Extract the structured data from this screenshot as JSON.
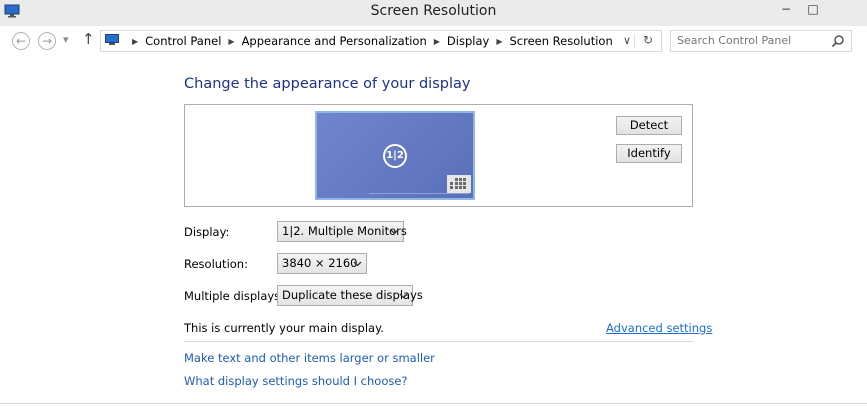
{
  "window": {
    "title": "Screen Resolution",
    "minimize_label": "−",
    "maximize_label": "□"
  },
  "nav": {
    "back_glyph": "←",
    "forward_glyph": "→",
    "recent_glyph": "▾",
    "up_glyph": "↑",
    "breadcrumbs": [
      "Control Panel",
      "Appearance and Personalization",
      "Display",
      "Screen Resolution"
    ],
    "crumb_sep": "▶",
    "dropdown_glyph": "∨",
    "refresh_glyph": "↻",
    "search_placeholder": "Search Control Panel"
  },
  "main": {
    "heading": "Change the appearance of your display",
    "monitor_label": "1|2",
    "detect_label": "Detect",
    "identify_label": "Identify",
    "display_label": "Display:",
    "display_value": "1|2. Multiple Monitors",
    "resolution_label": "Resolution:",
    "resolution_value": "3840 × 2160",
    "multiple_label": "Multiple displays:",
    "multiple_value": "Duplicate these displays",
    "main_display_text": "This is currently your main display.",
    "advanced_link": "Advanced settings",
    "link_text_size": "Make text and other items larger or smaller",
    "link_settings": "What display settings should I choose?"
  },
  "icons": {
    "app": "monitor-icon",
    "search": "magnifier-icon",
    "chevron": "chevron-down-icon"
  }
}
